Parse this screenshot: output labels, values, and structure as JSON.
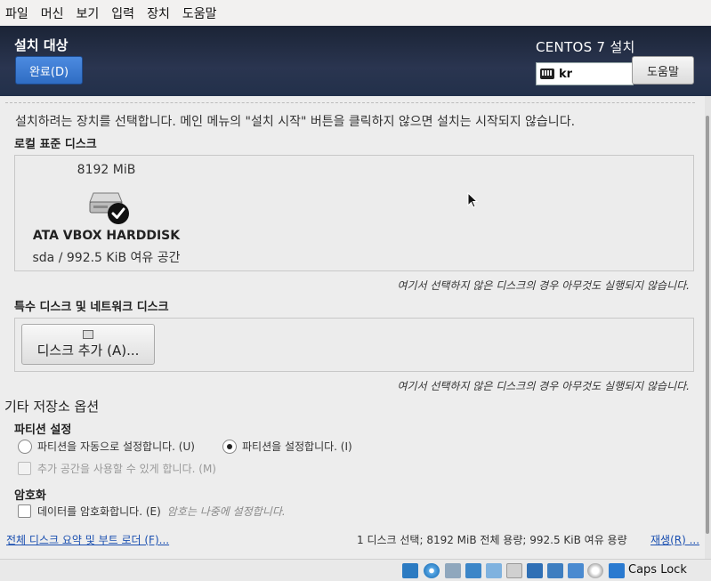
{
  "vm_menu": [
    "파일",
    "머신",
    "보기",
    "입력",
    "장치",
    "도움말"
  ],
  "header": {
    "title": "설치 대상",
    "done_label": "완료(D)",
    "product": "CENTOS 7 설치",
    "keyboard_layout": "kr",
    "help_label": "도움말"
  },
  "instruction": "설치하려는 장치를 선택합니다. 메인 메뉴의 \"설치 시작\" 버튼을 클릭하지 않으면 설치는 시작되지 않습니다.",
  "local_disks": {
    "label": "로컬 표준 디스크",
    "disks": [
      {
        "size": "8192 MiB",
        "name": "ATA VBOX HARDDISK",
        "device": "sda",
        "separator": "/",
        "free": "992.5 KiB 여유 공간",
        "selected": true
      }
    ],
    "note": "여기서 선택하지 않은 디스크의 경우 아무것도 실행되지 않습니다."
  },
  "special_disks": {
    "label": "특수 디스크 및 네트워크 디스크",
    "add_button": "디스크 추가 (A)...",
    "note": "여기서 선택하지 않은 디스크의 경우 아무것도 실행되지 않습니다."
  },
  "other_options": {
    "label": "기타 저장소 옵션",
    "partitioning_label": "파티션 설정",
    "auto_option": "파티션을 자동으로 설정합니다. (U)",
    "manual_option": "파티션을 설정합니다. (I)",
    "selected": "manual",
    "extra_space": "추가 공간을 사용할 수 있게 합니다. (M)",
    "encryption_label": "암호화",
    "encrypt_option": "데이터를 암호화합니다. (E)",
    "encrypt_hint": "암호는 나중에 설정합니다."
  },
  "footer": {
    "summary_link": "전체 디스크 요약 및 부트 로더 (F)...",
    "status": "1 디스크 선택; 8192 MiB 전체 용량; 992.5 KiB 여유 용량",
    "refresh_link": "재생(R) ..."
  },
  "vm_status": {
    "caps_label": "Caps Lock",
    "icons": [
      "audio-icon",
      "optical-disc-icon",
      "network-icon",
      "shared-folders-icon",
      "usb-icon",
      "display-icon",
      "screen-icon",
      "video-capture-icon",
      "cpu-icon",
      "mouse-integration-icon",
      "host-key-icon"
    ]
  }
}
